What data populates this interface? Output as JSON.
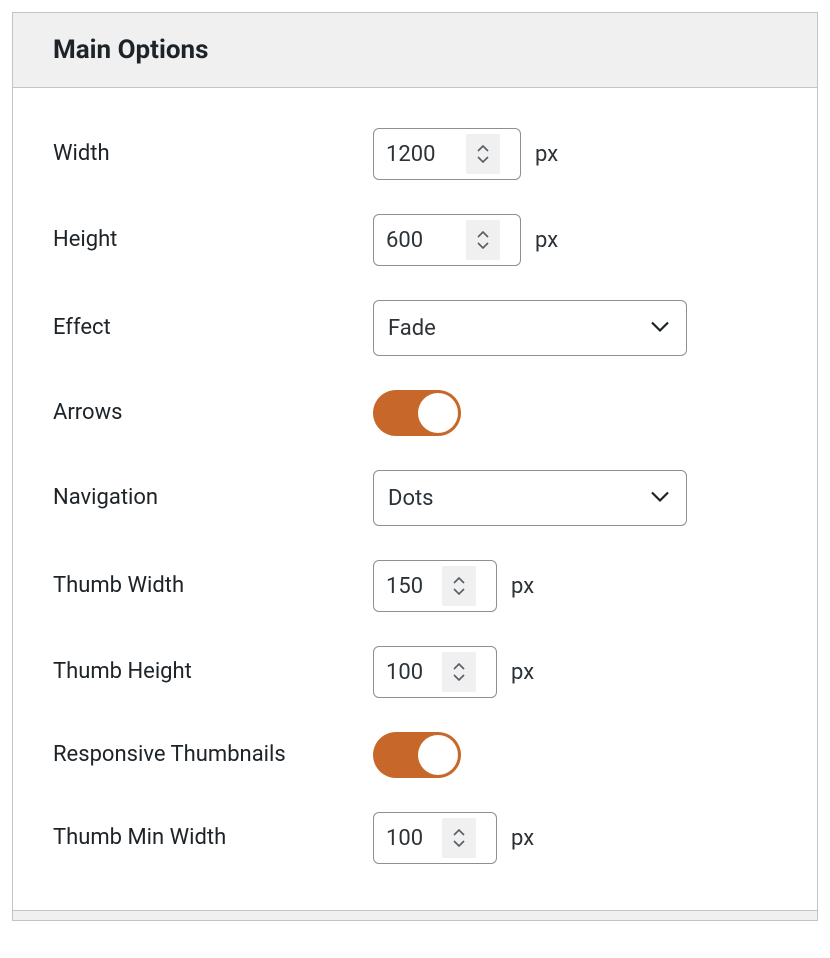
{
  "panel": {
    "title": "Main Options"
  },
  "fields": {
    "width": {
      "label": "Width",
      "value": "1200",
      "unit": "px"
    },
    "height": {
      "label": "Height",
      "value": "600",
      "unit": "px"
    },
    "effect": {
      "label": "Effect",
      "value": "Fade"
    },
    "arrows": {
      "label": "Arrows",
      "checked": true
    },
    "navigation": {
      "label": "Navigation",
      "value": "Dots"
    },
    "thumb_width": {
      "label": "Thumb Width",
      "value": "150",
      "unit": "px"
    },
    "thumb_height": {
      "label": "Thumb Height",
      "value": "100",
      "unit": "px"
    },
    "responsive_thumbs": {
      "label": "Responsive Thumbnails",
      "checked": true
    },
    "thumb_min_width": {
      "label": "Thumb Min Width",
      "value": "100",
      "unit": "px"
    }
  },
  "colors": {
    "accent": "#c7682a"
  }
}
